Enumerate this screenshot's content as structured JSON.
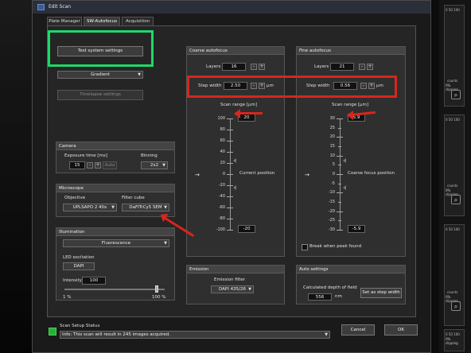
{
  "window": {
    "title": "Edit Scan"
  },
  "tabs": [
    {
      "label": "Plate Manager"
    },
    {
      "label": "SW-Autofocus"
    },
    {
      "label": "Acquisition"
    }
  ],
  "left": {
    "test_button": "Test system settings",
    "method_select": "Gradient",
    "timelapse_button": "Timelapse settings"
  },
  "camera": {
    "header": "Camera",
    "exposure_label": "Exposure time [ms]",
    "exposure_value": "15",
    "auto_label": "Auto",
    "binning_label": "Binning",
    "binning_value": "2x2"
  },
  "microscope": {
    "header": "Microscope",
    "objective_label": "Objective",
    "objective_value": "UPLSAPO 2 40x",
    "filter_label": "Filter cube",
    "filter_value": "DaFITrCy5 SEM"
  },
  "illumination": {
    "header": "Illumination",
    "mode_value": "Fluorescence",
    "led_label": "LED excitation",
    "led_value": "DAPI",
    "intensity_label": "Intensity",
    "intensity_value": "100",
    "slider_min": "1 %",
    "slider_max": "100 %",
    "slider_fraction": 0.92
  },
  "coarse": {
    "header": "Coarse autofocus",
    "layers_label": "Layers",
    "layers_value": "16",
    "step_label": "Step width",
    "step_value": "2.50",
    "step_unit": "µm",
    "range_label": "Scan range [µm]",
    "top_value": "20",
    "bottom_value": "-20",
    "ticks": [
      "100",
      "80",
      "60",
      "40",
      "20",
      "0",
      "-20",
      "-40",
      "-60",
      "-80",
      "-100"
    ],
    "current_label": "Current position"
  },
  "fine": {
    "header": "Fine autofocus",
    "layers_label": "Layers",
    "layers_value": "21",
    "step_label": "Step width",
    "step_value": "0.56",
    "step_unit": "µm",
    "range_label": "Scan range [µm]",
    "top_value": "5.9",
    "bottom_value": "-5.9",
    "ticks": [
      "30",
      "25",
      "20",
      "15",
      "10",
      "5",
      "0",
      "-5",
      "-10",
      "-15",
      "-20",
      "-25",
      "-30"
    ],
    "current_label": "Coarse focus position",
    "break_label": "Break when peak found"
  },
  "emission": {
    "header": "Emission",
    "filter_label": "Emission filter",
    "filter_value": "DAPI 435/26"
  },
  "auto": {
    "header": "Auto settings",
    "dof_label": "Calculated depth of field",
    "dof_value": "556",
    "dof_unit": "nm",
    "set_button": "Set as step width"
  },
  "status": {
    "title": "Scan Setup Status",
    "message": "Info: This scan will result in 245 images acquired.",
    "cancel": "Cancel",
    "ok": "OK"
  },
  "right_tiles": [
    {
      "axis": [
        "0",
        "50",
        "100"
      ],
      "counts": "counts",
      "clipping": "0% clipping"
    },
    {
      "axis": [
        "0",
        "50",
        "100"
      ],
      "counts": "counts",
      "clipping": "0% clipping"
    },
    {
      "axis": [
        "0",
        "50",
        "100"
      ],
      "counts": "counts",
      "clipping": "0% clipping"
    },
    {
      "axis": [
        "0",
        "50",
        "100"
      ],
      "counts": "counts",
      "clipping": "0% clipping"
    }
  ],
  "colors": {
    "highlight_red": "#d8261c",
    "highlight_green": "#1fd86a",
    "status_ok": "#22b33a"
  }
}
